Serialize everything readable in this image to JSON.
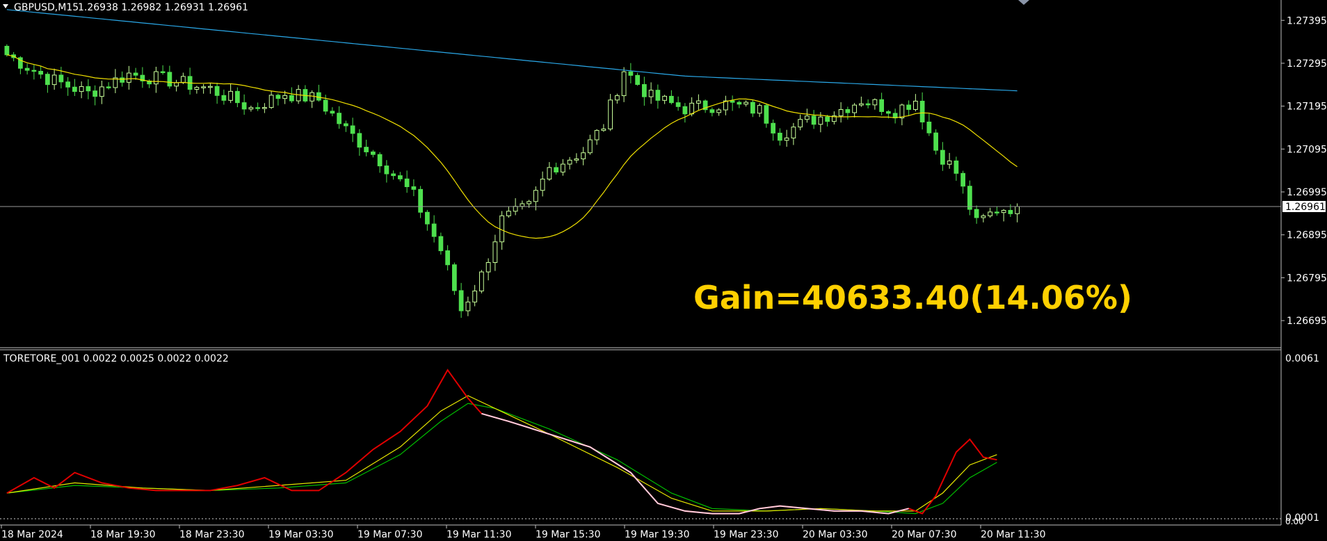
{
  "header": {
    "symbol_label": "GBPUSD,M15",
    "ohlc_label": "1.26938 1.26982 1.26931 1.26961"
  },
  "indicator": {
    "label": "TORETORE_001 0.0022 0.0025 0.0022 0.0022",
    "scale_top": "0.0061",
    "scale_bottom": "0.0001",
    "scale_zero": "0.00"
  },
  "gain_text": "Gain=40633.40(14.06%)",
  "current_price_label": "1.26961",
  "colors": {
    "background": "#000000",
    "bull_candle": "#c8ff9a",
    "bear_candle": "#4ee04e",
    "ma_fast": "#f0e000",
    "ma_slow": "#2aa8e8",
    "osc_main": "#e00000",
    "osc_alt": "#ffd0e0",
    "osc_signal1": "#e8e800",
    "osc_signal2": "#00c000",
    "gain": "#FFD000"
  },
  "chart_data": [
    {
      "type": "candlestick",
      "title": "GBPUSD,M15",
      "y_ticks": [
        "1.27395",
        "1.27295",
        "1.27195",
        "1.27095",
        "1.26995",
        "1.26895",
        "1.26795",
        "1.26695"
      ],
      "ylim": [
        1.2664,
        1.2741
      ],
      "x_ticks": [
        "18 Mar 2024",
        "18 Mar 19:30",
        "18 Mar 23:30",
        "19 Mar 03:30",
        "19 Mar 07:30",
        "19 Mar 11:30",
        "19 Mar 15:30",
        "19 Mar 19:30",
        "19 Mar 23:30",
        "20 Mar 03:30",
        "20 Mar 07:30",
        "20 Mar 11:30"
      ],
      "close_path": [
        {
          "bar": 0,
          "close": 1.27315
        },
        {
          "bar": 6,
          "close": 1.2726
        },
        {
          "bar": 12,
          "close": 1.27225
        },
        {
          "bar": 18,
          "close": 1.2727
        },
        {
          "bar": 24,
          "close": 1.27255
        },
        {
          "bar": 30,
          "close": 1.27235
        },
        {
          "bar": 36,
          "close": 1.2719
        },
        {
          "bar": 41,
          "close": 1.27225
        },
        {
          "bar": 46,
          "close": 1.2721
        },
        {
          "bar": 50,
          "close": 1.2714
        },
        {
          "bar": 55,
          "close": 1.2707
        },
        {
          "bar": 60,
          "close": 1.26985
        },
        {
          "bar": 64,
          "close": 1.2686
        },
        {
          "bar": 67,
          "close": 1.2672
        },
        {
          "bar": 70,
          "close": 1.268
        },
        {
          "bar": 73,
          "close": 1.2693
        },
        {
          "bar": 77,
          "close": 1.2696
        },
        {
          "bar": 80,
          "close": 1.2705
        },
        {
          "bar": 85,
          "close": 1.2709
        },
        {
          "bar": 88,
          "close": 1.2715
        },
        {
          "bar": 91,
          "close": 1.2728
        },
        {
          "bar": 95,
          "close": 1.27215
        },
        {
          "bar": 100,
          "close": 1.2719
        },
        {
          "bar": 106,
          "close": 1.272
        },
        {
          "bar": 111,
          "close": 1.27185
        },
        {
          "bar": 114,
          "close": 1.2713
        },
        {
          "bar": 118,
          "close": 1.2716
        },
        {
          "bar": 122,
          "close": 1.2718
        },
        {
          "bar": 126,
          "close": 1.2721
        },
        {
          "bar": 131,
          "close": 1.27185
        },
        {
          "bar": 134,
          "close": 1.2721
        },
        {
          "bar": 137,
          "close": 1.27095
        },
        {
          "bar": 140,
          "close": 1.2704
        },
        {
          "bar": 143,
          "close": 1.2692
        },
        {
          "bar": 146,
          "close": 1.26955
        },
        {
          "bar": 149,
          "close": 1.26961
        }
      ],
      "ma_fast_label": "MA (yellow)",
      "ma_slow_label": "MA (blue)",
      "current_price": 1.26961
    },
    {
      "type": "line",
      "title": "TORETORE_001",
      "ylim": [
        0.0,
        0.0064
      ],
      "series": [
        {
          "name": "main",
          "points": [
            [
              0,
              0.001
            ],
            [
              4,
              0.0016
            ],
            [
              7,
              0.0012
            ],
            [
              10,
              0.0018
            ],
            [
              14,
              0.0014
            ],
            [
              18,
              0.0012
            ],
            [
              22,
              0.0011
            ],
            [
              26,
              0.0011
            ],
            [
              30,
              0.0011
            ],
            [
              34,
              0.0013
            ],
            [
              38,
              0.0016
            ],
            [
              42,
              0.0011
            ],
            [
              46,
              0.0011
            ],
            [
              50,
              0.0018
            ],
            [
              54,
              0.0027
            ],
            [
              58,
              0.0034
            ],
            [
              62,
              0.0044
            ],
            [
              65,
              0.0058
            ],
            [
              68,
              0.0047
            ],
            [
              70,
              0.0041
            ],
            [
              74,
              0.0038
            ],
            [
              80,
              0.0033
            ],
            [
              86,
              0.0028
            ],
            [
              92,
              0.0018
            ],
            [
              96,
              0.0006
            ],
            [
              100,
              0.0003
            ],
            [
              104,
              0.0002
            ],
            [
              108,
              0.0002
            ],
            [
              111,
              0.0004
            ],
            [
              114,
              0.0005
            ],
            [
              118,
              0.0004
            ],
            [
              122,
              0.0003
            ],
            [
              126,
              0.0003
            ],
            [
              130,
              0.0002
            ],
            [
              133,
              0.0004
            ],
            [
              135,
              0.0002
            ],
            [
              137,
              0.0009
            ],
            [
              140,
              0.0026
            ],
            [
              142,
              0.0031
            ],
            [
              144,
              0.0024
            ],
            [
              146,
              0.0023
            ]
          ]
        },
        {
          "name": "signal1",
          "points": [
            [
              0,
              0.001
            ],
            [
              10,
              0.0014
            ],
            [
              20,
              0.0012
            ],
            [
              30,
              0.0011
            ],
            [
              40,
              0.0013
            ],
            [
              50,
              0.0015
            ],
            [
              58,
              0.0028
            ],
            [
              64,
              0.0042
            ],
            [
              68,
              0.0048
            ],
            [
              72,
              0.0043
            ],
            [
              80,
              0.0033
            ],
            [
              90,
              0.002
            ],
            [
              98,
              0.0008
            ],
            [
              104,
              0.0003
            ],
            [
              112,
              0.0003
            ],
            [
              120,
              0.0004
            ],
            [
              128,
              0.0003
            ],
            [
              134,
              0.0003
            ],
            [
              138,
              0.001
            ],
            [
              142,
              0.0021
            ],
            [
              146,
              0.0025
            ]
          ]
        },
        {
          "name": "signal2",
          "points": [
            [
              0,
              0.001
            ],
            [
              10,
              0.0013
            ],
            [
              20,
              0.0012
            ],
            [
              30,
              0.0011
            ],
            [
              40,
              0.0012
            ],
            [
              50,
              0.0014
            ],
            [
              58,
              0.0025
            ],
            [
              64,
              0.0038
            ],
            [
              68,
              0.0045
            ],
            [
              72,
              0.0043
            ],
            [
              80,
              0.0035
            ],
            [
              90,
              0.0023
            ],
            [
              98,
              0.001
            ],
            [
              104,
              0.0004
            ],
            [
              112,
              0.0003
            ],
            [
              120,
              0.0004
            ],
            [
              128,
              0.0003
            ],
            [
              134,
              0.0002
            ],
            [
              138,
              0.0006
            ],
            [
              142,
              0.0016
            ],
            [
              146,
              0.0022
            ]
          ]
        }
      ]
    }
  ]
}
